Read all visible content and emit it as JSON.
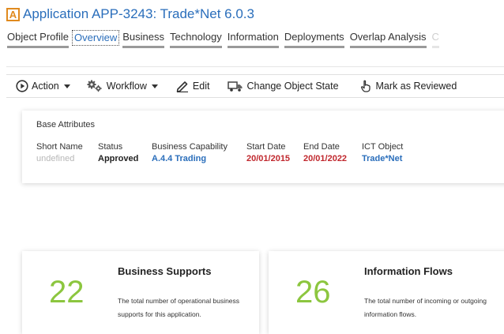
{
  "header": {
    "badge": "A",
    "title": "Application APP-3243: Trade*Net 6.0.3"
  },
  "tabs": [
    {
      "label": "Object Profile"
    },
    {
      "label": "Overview"
    },
    {
      "label": "Business"
    },
    {
      "label": "Technology"
    },
    {
      "label": "Information"
    },
    {
      "label": "Deployments"
    },
    {
      "label": "Overlap Analysis"
    },
    {
      "label": "C"
    }
  ],
  "toolbar": {
    "action_label": "Action",
    "workflow_label": "Workflow",
    "edit_label": "Edit",
    "change_state_label": "Change Object State",
    "mark_reviewed_label": "Mark as Reviewed"
  },
  "base_attributes": {
    "heading": "Base Attributes",
    "fields": [
      {
        "label": "Short Name",
        "value": "undefined"
      },
      {
        "label": "Status",
        "value": "Approved"
      },
      {
        "label": "Business Capability",
        "value": "A.4.4 Trading"
      },
      {
        "label": "Start Date",
        "value": "20/01/2015"
      },
      {
        "label": "End Date",
        "value": "20/01/2022"
      },
      {
        "label": "ICT Object",
        "value": "Trade*Net"
      }
    ]
  },
  "stats": [
    {
      "number": "22",
      "title": "Business Supports",
      "description": "The total number of operational business supports for this application."
    },
    {
      "number": "26",
      "title": "Information Flows",
      "description": "The total number of incoming or outgoing information flows."
    }
  ],
  "colors": {
    "accent_blue": "#2a6ebb",
    "badge_orange": "#e08a1e",
    "date_red": "#c0272d",
    "stat_green": "#8cc63f"
  },
  "icons": [
    "play-circle-icon",
    "gears-icon",
    "pencil-icon",
    "truck-icon",
    "hand-pointer-icon"
  ]
}
